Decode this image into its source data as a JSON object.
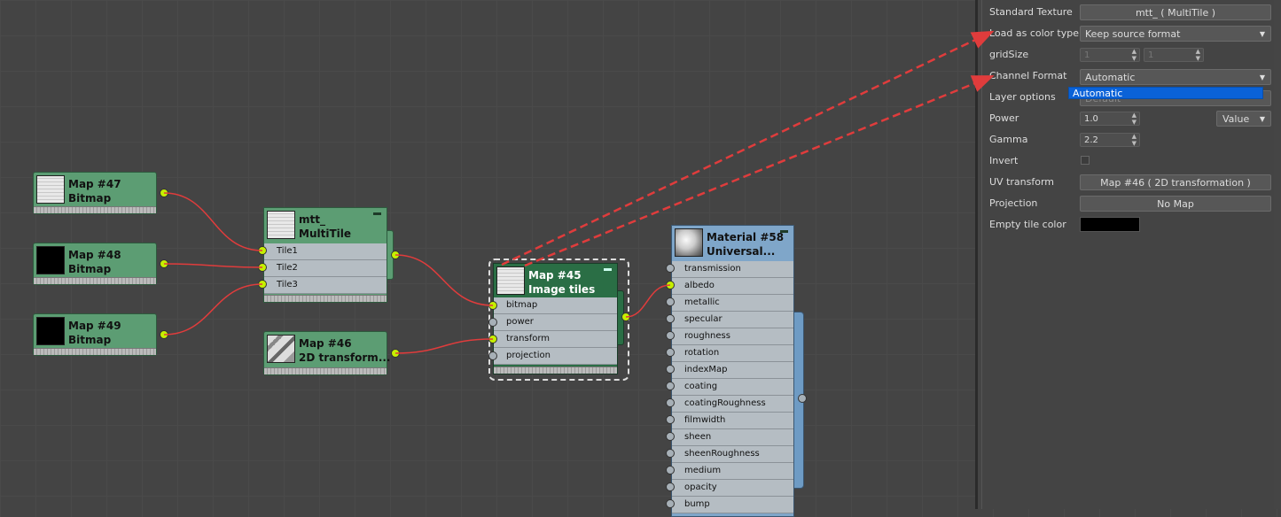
{
  "nodes": {
    "map47": {
      "name": "Map #47",
      "type": "Bitmap"
    },
    "map48": {
      "name": "Map #48",
      "type": "Bitmap"
    },
    "map49": {
      "name": "Map #49",
      "type": "Bitmap"
    },
    "multitile": {
      "name": "mtt_",
      "type": "MultiTile",
      "ports": [
        "Tile1",
        "Tile2",
        "Tile3"
      ]
    },
    "map46": {
      "name": "Map #46",
      "type": "2D transform..."
    },
    "map45": {
      "name": "Map #45",
      "type": "Image tiles",
      "ports": [
        "bitmap",
        "power",
        "transform",
        "projection"
      ]
    },
    "material58": {
      "name": "Material #58",
      "type": "Universal...",
      "ports": [
        "transmission",
        "albedo",
        "metallic",
        "specular",
        "roughness",
        "rotation",
        "indexMap",
        "coating",
        "coatingRoughness",
        "filmwidth",
        "sheen",
        "sheenRoughness",
        "medium",
        "opacity",
        "bump"
      ]
    }
  },
  "panel": {
    "standard_texture": {
      "label": "Standard Texture",
      "value": "mtt_  ( MultiTile )"
    },
    "load_as_color_type": {
      "label": "Load as color type",
      "value": "Keep source format"
    },
    "grid_size": {
      "label": "gridSize",
      "x": "1",
      "y": "1"
    },
    "channel_format": {
      "label": "Channel Format",
      "value": "Automatic",
      "dropdown_option": "Automatic"
    },
    "layer_options": {
      "label": "Layer options",
      "value": "Default"
    },
    "power": {
      "label": "Power",
      "value": "1.0",
      "mode": "Value"
    },
    "gamma": {
      "label": "Gamma",
      "value": "2.2"
    },
    "invert": {
      "label": "Invert"
    },
    "uv_transform": {
      "label": "UV transform",
      "value": "Map #46  ( 2D transformation )"
    },
    "projection": {
      "label": "Projection",
      "value": "No Map"
    },
    "empty_tile_color": {
      "label": "Empty tile color",
      "color": "#000000"
    }
  },
  "colors": {
    "map_node": "#5c9d73",
    "selected_node": "#2a6e45",
    "material_node": "#7fa6c9",
    "wire": "#e03c3c",
    "socket_on": "#c6f000",
    "canvas": "#444444"
  }
}
